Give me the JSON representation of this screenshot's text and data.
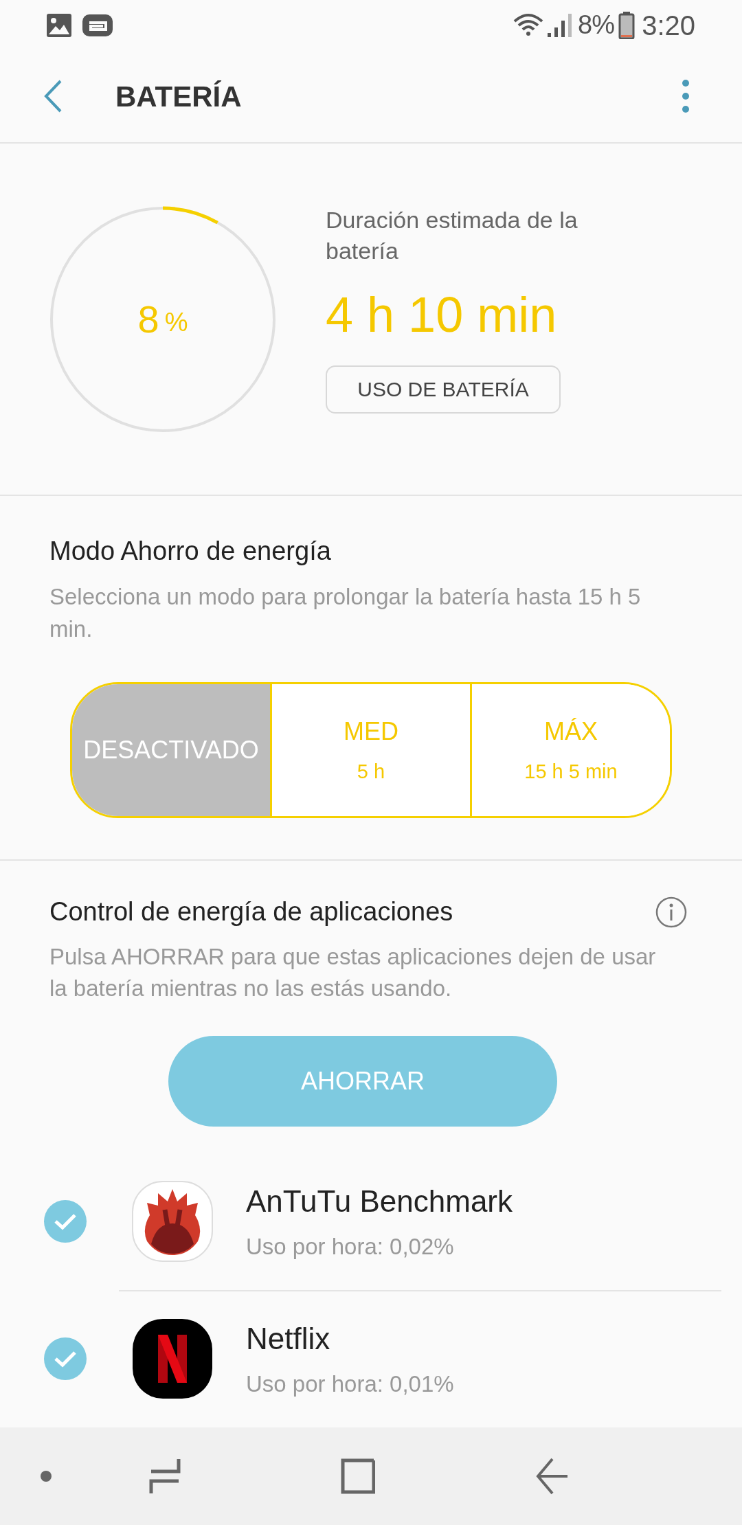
{
  "status_bar": {
    "battery_text": "8%",
    "time": "3:20"
  },
  "app_bar": {
    "title": "BATERÍA"
  },
  "battery": {
    "percent": "8",
    "percent_sign": "%",
    "estimate_label": "Duración estimada de la batería",
    "estimate": "4 h 10 min",
    "usage_button": "USO DE BATERÍA"
  },
  "power_saving": {
    "title": "Modo Ahorro de energía",
    "description": "Selecciona un modo para prolongar la batería hasta 15 h 5 min.",
    "modes": [
      {
        "label": "DESACTIVADO",
        "selected": true
      },
      {
        "label": "MED",
        "duration": "5 h",
        "selected": false
      },
      {
        "label": "MÁX",
        "duration": "15 h 5 min",
        "selected": false
      }
    ]
  },
  "app_power": {
    "title": "Control de energía de aplicaciones",
    "description": "Pulsa AHORRAR para que estas aplicaciones dejen de usar la batería mientras no las estás usando.",
    "button": "AHORRAR",
    "apps": [
      {
        "name": "AnTuTu Benchmark",
        "usage": "Uso por hora: 0,02%",
        "checked": true,
        "kind": "flame"
      },
      {
        "name": "Netflix",
        "usage": "Uso por hora: 0,01%",
        "checked": true,
        "kind": "letter"
      }
    ]
  }
}
